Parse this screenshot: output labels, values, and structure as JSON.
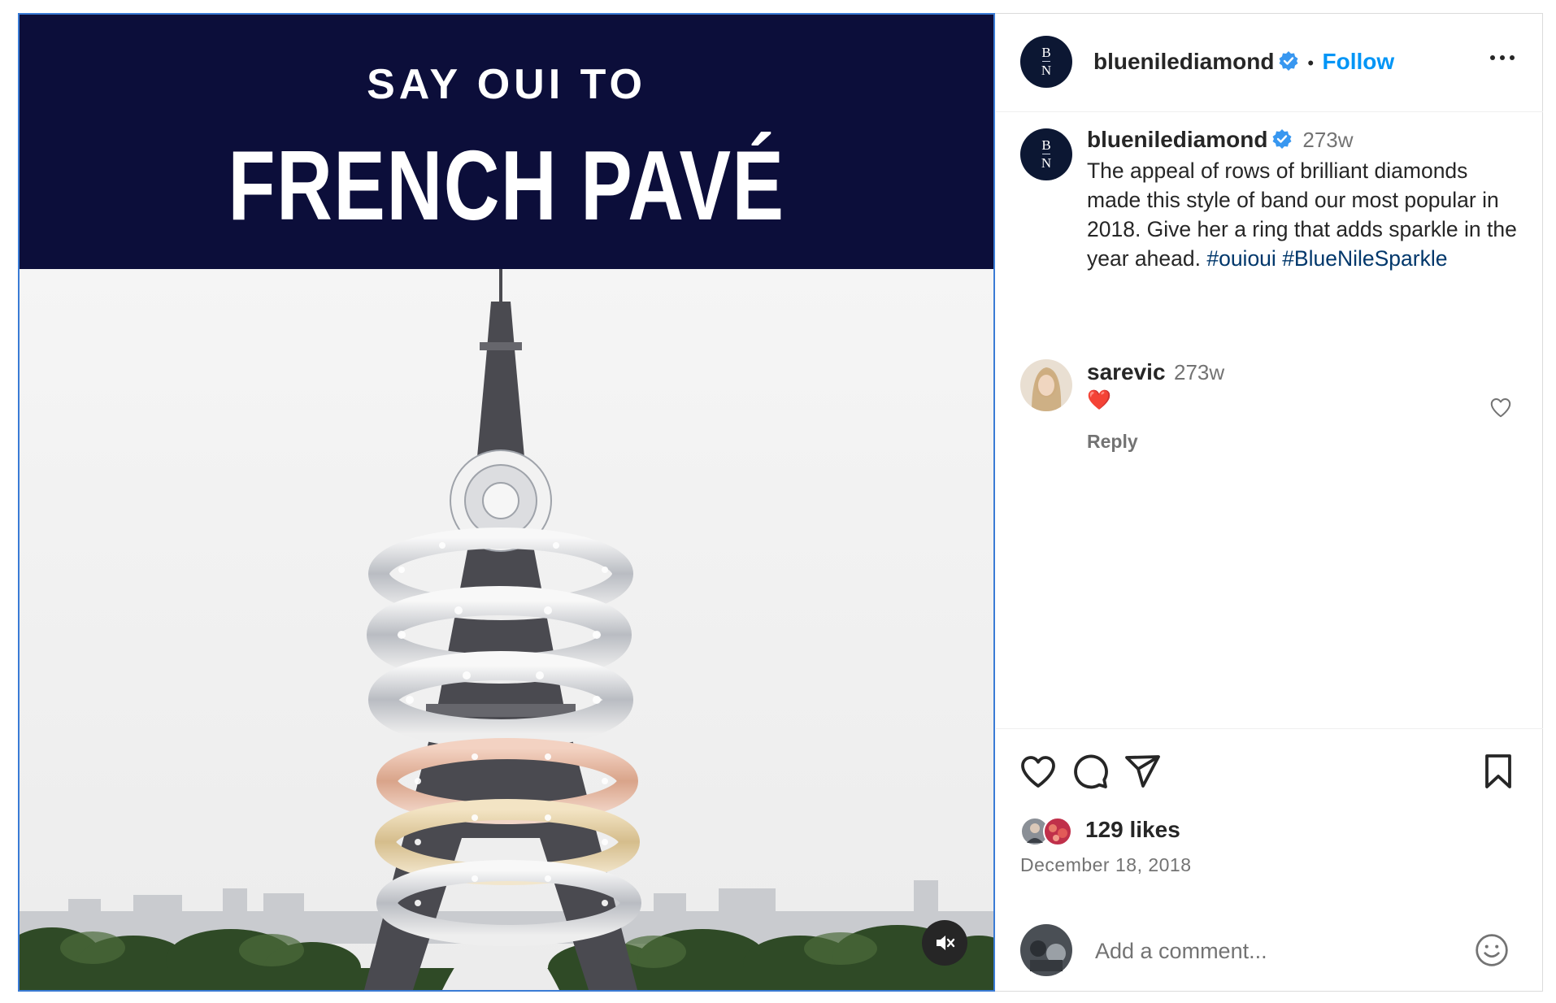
{
  "post": {
    "banner_line1": "SAY OUI TO",
    "banner_line2": "FRENCH PAVÉ"
  },
  "header": {
    "avatar_letters": [
      "B",
      "N"
    ],
    "username": "bluenilediamond",
    "separator": "•",
    "follow_label": "Follow"
  },
  "caption": {
    "username": "bluenilediamond",
    "time": "273w",
    "text": "The appeal of rows of brilliant diamonds made this style of band our most popular in 2018. Give her a ring that adds sparkle in the year ahead.",
    "hashtags": [
      "#ouioui",
      "#BlueNileSparkle"
    ]
  },
  "comments": [
    {
      "username": "sarevic",
      "time": "273w",
      "text": "❤️",
      "reply_label": "Reply"
    }
  ],
  "stats": {
    "likes": "129 likes",
    "date": "December 18, 2018"
  },
  "comment_box": {
    "placeholder": "Add a comment..."
  },
  "colors": {
    "follow": "#0095f6",
    "hashtag": "#00376b",
    "banner": "#0c0e3a",
    "verified": "#3897f0"
  },
  "icons": [
    "verified-icon",
    "more-options-icon",
    "heart-icon",
    "comment-icon",
    "share-icon",
    "bookmark-icon",
    "mute-icon",
    "emoji-icon"
  ]
}
